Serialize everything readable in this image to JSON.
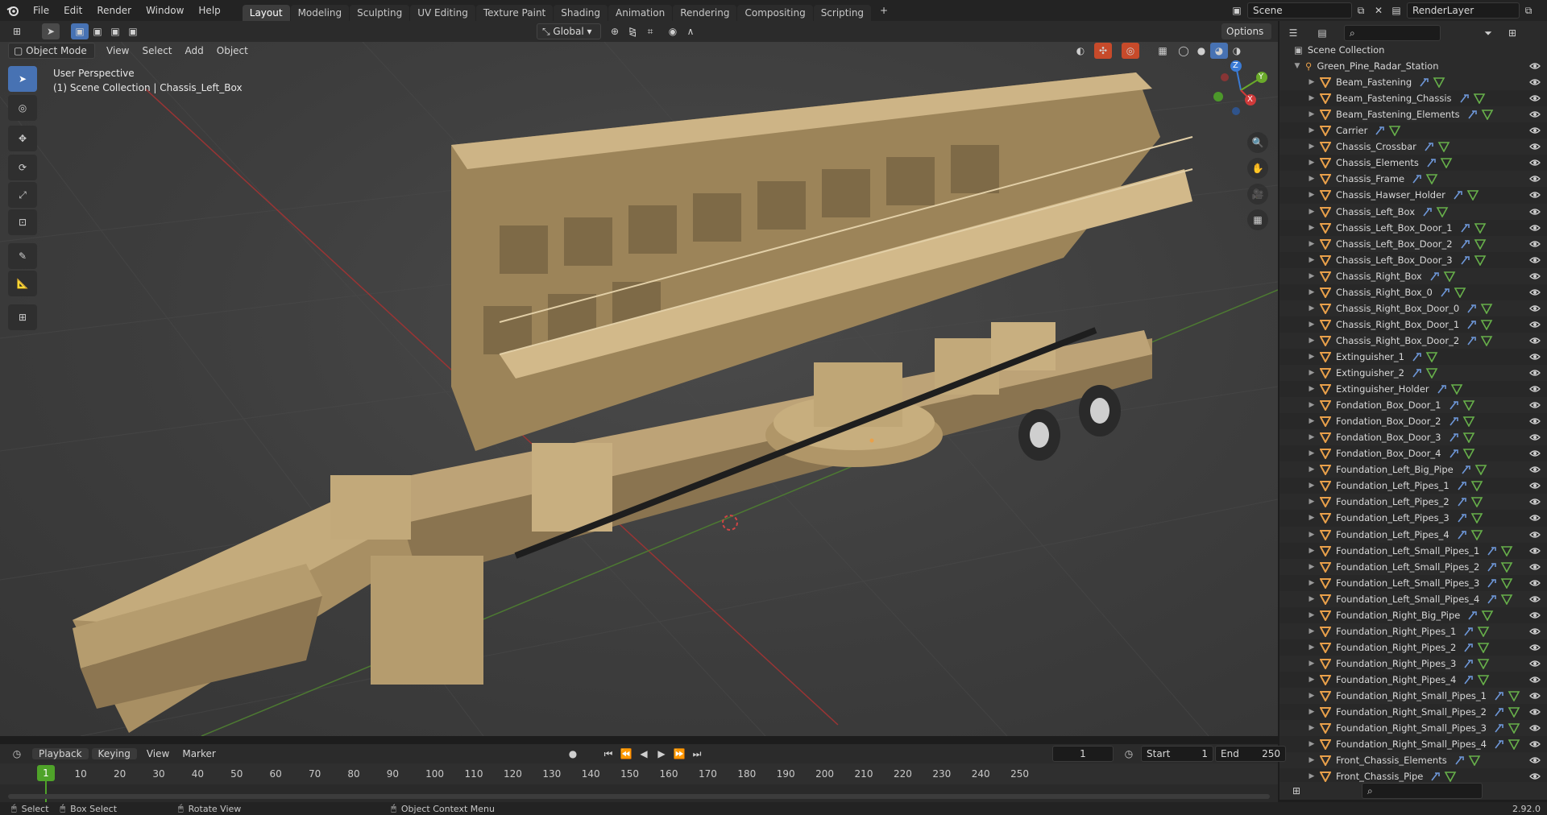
{
  "app": {
    "version": "2.92.0"
  },
  "menu": [
    "File",
    "Edit",
    "Render",
    "Window",
    "Help"
  ],
  "workspaces": {
    "tabs": [
      "Layout",
      "Modeling",
      "Sculpting",
      "UV Editing",
      "Texture Paint",
      "Shading",
      "Animation",
      "Rendering",
      "Compositing",
      "Scripting"
    ],
    "active": "Layout",
    "add": "+"
  },
  "scene": {
    "label": "Scene",
    "render_layer": "RenderLayer"
  },
  "viewport": {
    "mode": "Object Mode",
    "menus": [
      "View",
      "Select",
      "Add",
      "Object"
    ],
    "transform": "Global",
    "options": "Options",
    "info_line1": "User Perspective",
    "info_line2": "(1) Scene Collection | Chassis_Left_Box",
    "axes": {
      "z": "Z",
      "y": "Y",
      "x": "X"
    }
  },
  "outliner": {
    "root": "Scene Collection",
    "collection": "Green_Pine_Radar_Station",
    "items": [
      "Beam_Fastening",
      "Beam_Fastening_Chassis",
      "Beam_Fastening_Elements",
      "Carrier",
      "Chassis_Crossbar",
      "Chassis_Elements",
      "Chassis_Frame",
      "Chassis_Hawser_Holder",
      "Chassis_Left_Box",
      "Chassis_Left_Box_Door_1",
      "Chassis_Left_Box_Door_2",
      "Chassis_Left_Box_Door_3",
      "Chassis_Right_Box",
      "Chassis_Right_Box_0",
      "Chassis_Right_Box_Door_0",
      "Chassis_Right_Box_Door_1",
      "Chassis_Right_Box_Door_2",
      "Extinguisher_1",
      "Extinguisher_2",
      "Extinguisher_Holder",
      "Fondation_Box_Door_1",
      "Fondation_Box_Door_2",
      "Fondation_Box_Door_3",
      "Fondation_Box_Door_4",
      "Foundation_Left_Big_Pipe",
      "Foundation_Left_Pipes_1",
      "Foundation_Left_Pipes_2",
      "Foundation_Left_Pipes_3",
      "Foundation_Left_Pipes_4",
      "Foundation_Left_Small_Pipes_1",
      "Foundation_Left_Small_Pipes_2",
      "Foundation_Left_Small_Pipes_3",
      "Foundation_Left_Small_Pipes_4",
      "Foundation_Right_Big_Pipe",
      "Foundation_Right_Pipes_1",
      "Foundation_Right_Pipes_2",
      "Foundation_Right_Pipes_3",
      "Foundation_Right_Pipes_4",
      "Foundation_Right_Small_Pipes_1",
      "Foundation_Right_Small_Pipes_2",
      "Foundation_Right_Small_Pipes_3",
      "Foundation_Right_Small_Pipes_4",
      "Front_Chassis_Elements",
      "Front_Chassis_Pipe"
    ]
  },
  "timeline": {
    "menus": [
      "Playback",
      "Keying",
      "View",
      "Marker"
    ],
    "current_frame": "1",
    "start_label": "Start",
    "start": "1",
    "end_label": "End",
    "end": "250",
    "ticks": [
      "1",
      "10",
      "20",
      "30",
      "40",
      "50",
      "60",
      "70",
      "80",
      "90",
      "100",
      "110",
      "120",
      "130",
      "140",
      "150",
      "160",
      "170",
      "180",
      "190",
      "200",
      "210",
      "220",
      "230",
      "240",
      "250"
    ]
  },
  "status": {
    "select": "Select",
    "box_select": "Box Select",
    "rotate": "Rotate View",
    "context": "Object Context Menu"
  },
  "colors": {
    "accent": "#4772b3",
    "object": "#e9a04a",
    "frame": "#4fa329"
  }
}
